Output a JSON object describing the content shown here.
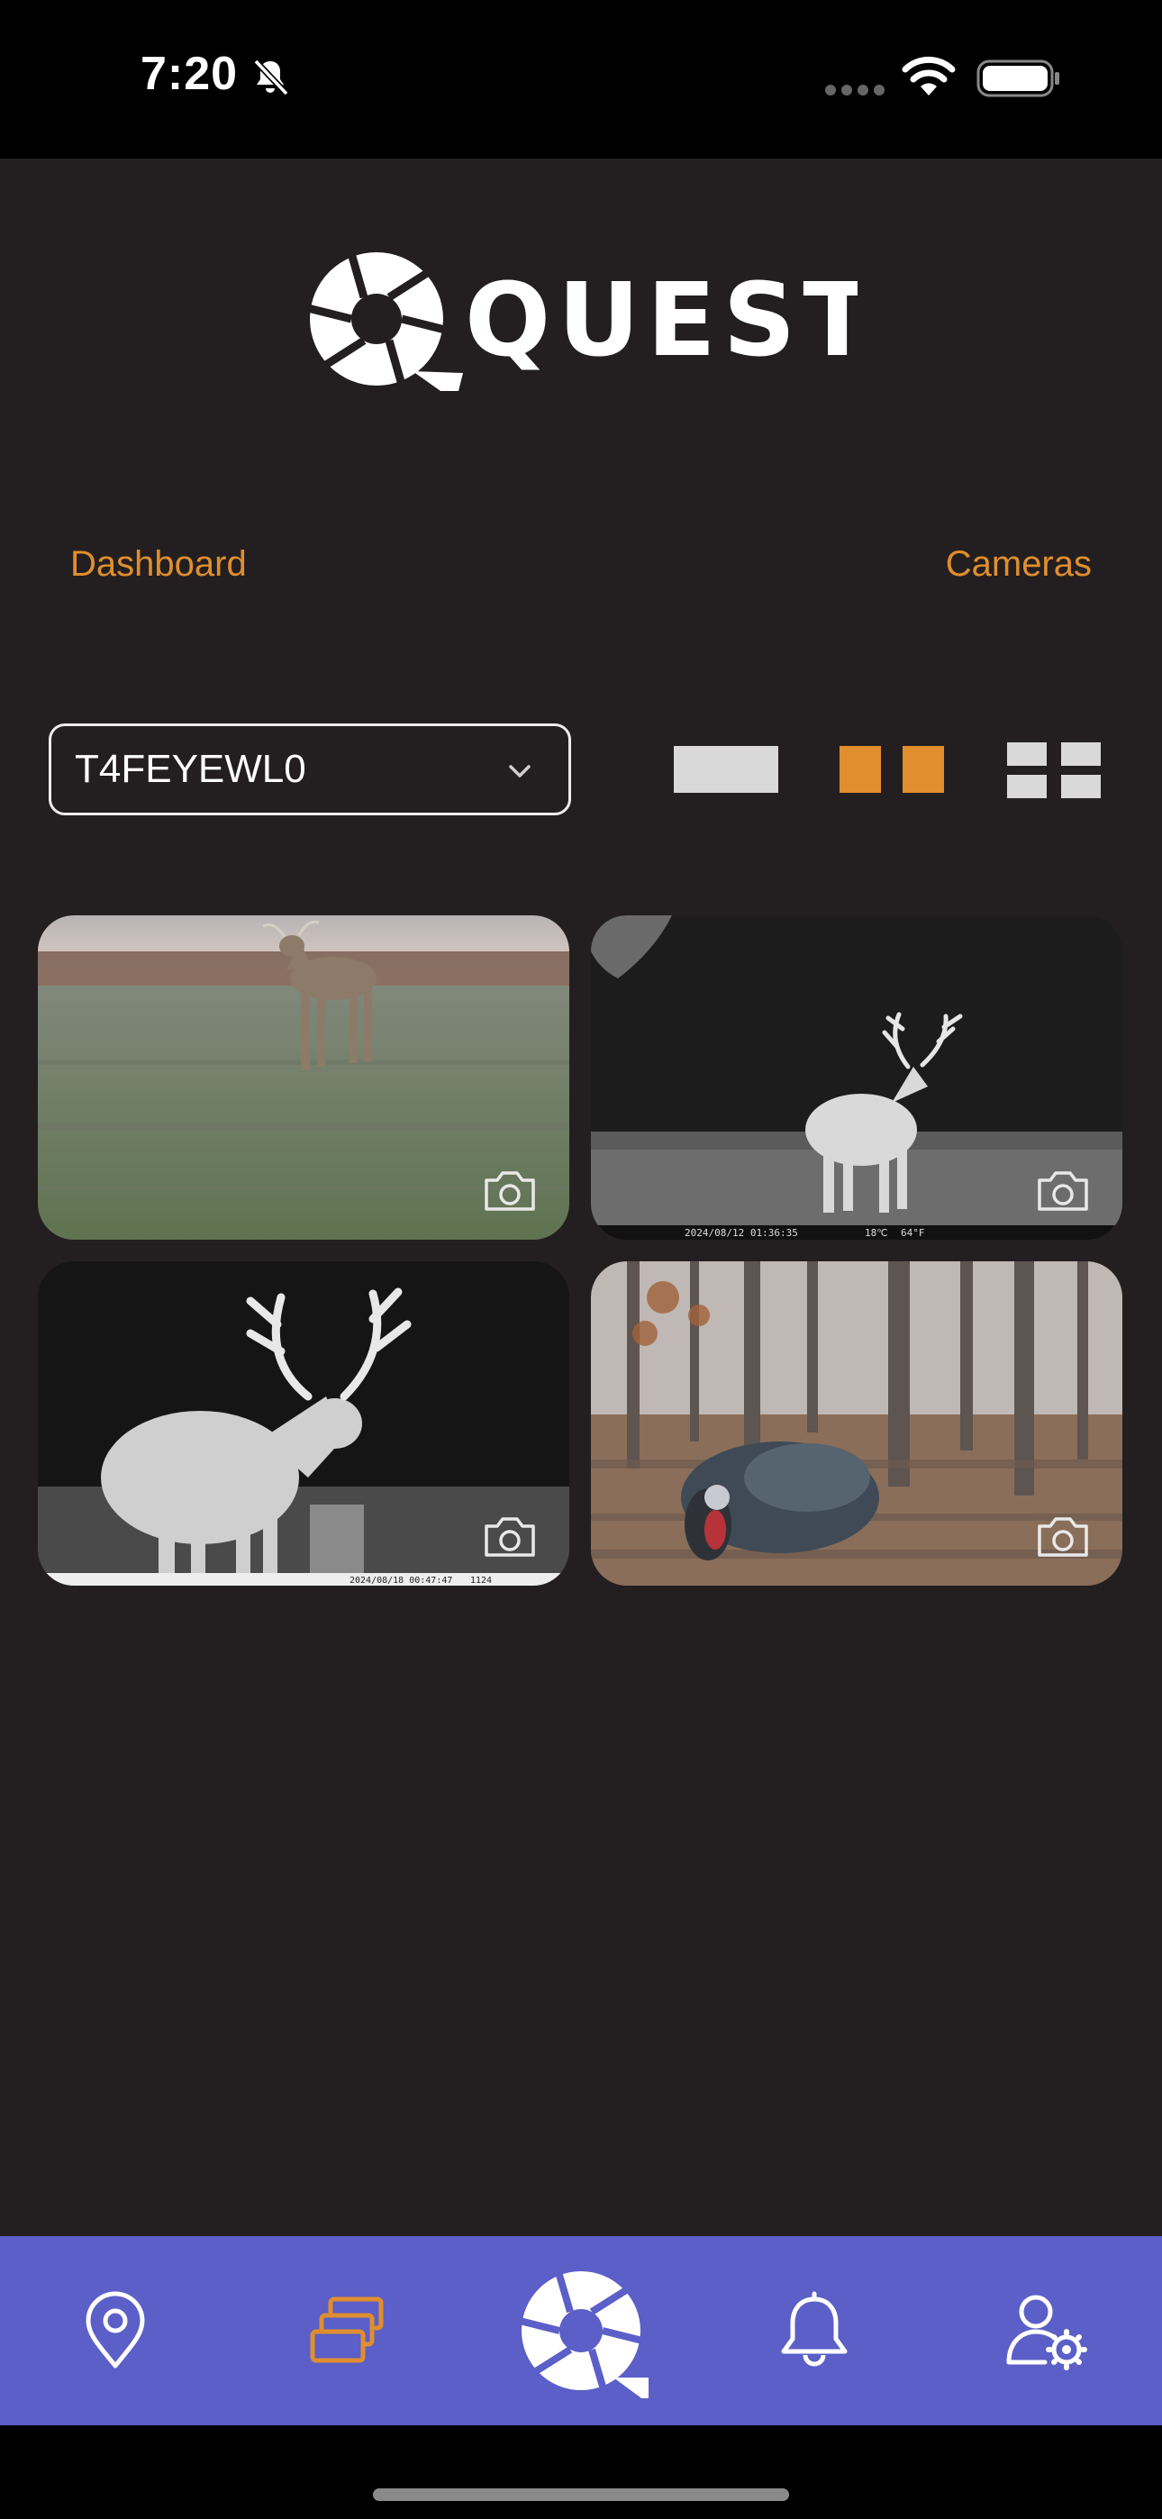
{
  "status_bar": {
    "time": "7:20"
  },
  "nav": {
    "dashboard_label": "Dashboard",
    "cameras_label": "Cameras"
  },
  "camera_select": {
    "value": "T4FEYEWL0"
  },
  "layout_options": {
    "selected": "two-column"
  },
  "gallery": {
    "photos": [
      {
        "timestamp": ""
      },
      {
        "timestamp": "2024/08/12  01:36:35",
        "temp_c": "18℃",
        "temp_f": "64°F"
      },
      {
        "timestamp": "2024/08/18  00:47:47",
        "extra": "1124"
      },
      {
        "timestamp": ""
      }
    ]
  },
  "colors": {
    "background": "#231f20",
    "accent": "#e08e2e",
    "tabbar": "#5b5fc7"
  },
  "icons": {
    "map": "map-pin-icon",
    "gallery": "gallery-stack-icon",
    "home": "quest-aperture-icon",
    "alerts": "bell-icon",
    "account": "user-settings-icon"
  }
}
